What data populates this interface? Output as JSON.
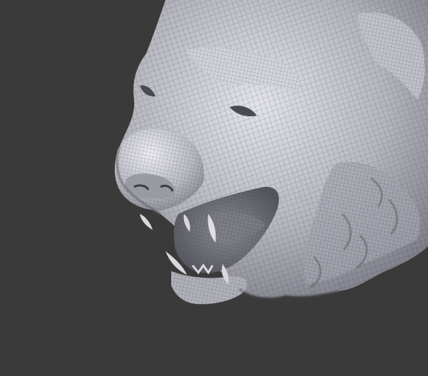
{
  "viewport": {
    "background_color": "#3a3a3a",
    "object": "tiger-head-sculpt",
    "display_mode": "wireframe-on-shaded",
    "colors": {
      "mesh_base": "#b6b6bf",
      "mesh_light": "#e3e3ea",
      "mesh_shadow": "#5b5b64",
      "wire_color": "#2e2e36",
      "mouth_interior": "#6f6f78",
      "teeth": "#d8d8de"
    }
  }
}
